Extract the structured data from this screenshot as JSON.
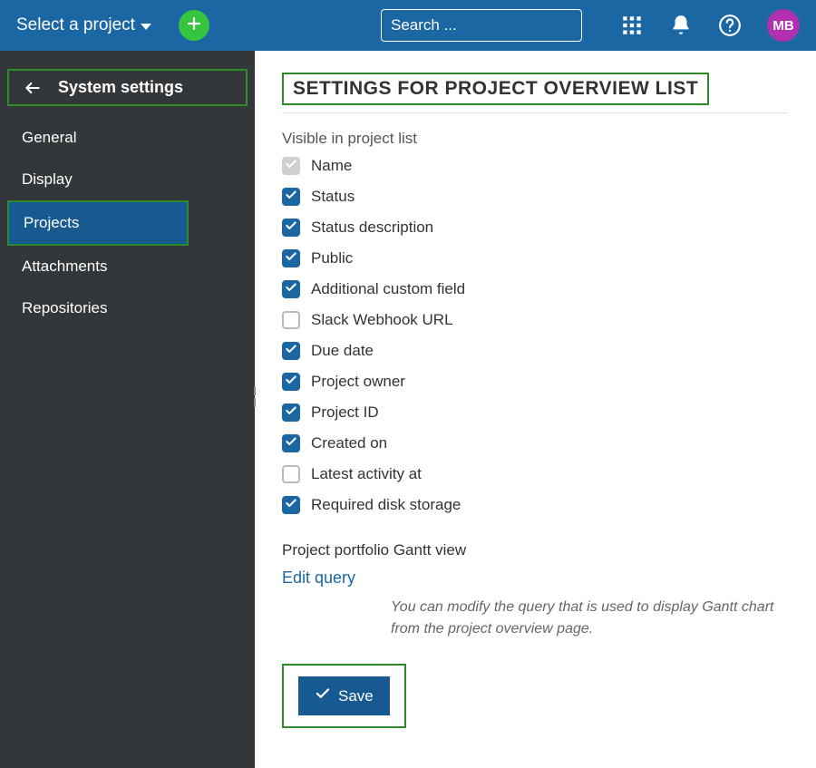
{
  "header": {
    "project_selector_label": "Select a project",
    "search_placeholder": "Search ...",
    "avatar_initials": "MB"
  },
  "sidebar": {
    "title": "System settings",
    "items": [
      {
        "label": "General",
        "active": false
      },
      {
        "label": "Display",
        "active": false
      },
      {
        "label": "Projects",
        "active": true
      },
      {
        "label": "Attachments",
        "active": false
      },
      {
        "label": "Repositories",
        "active": false
      }
    ]
  },
  "main": {
    "title": "SETTINGS FOR PROJECT OVERVIEW LIST",
    "visible_section_label": "Visible in project list",
    "visible_options": [
      {
        "label": "Name",
        "checked": true,
        "disabled": true
      },
      {
        "label": "Status",
        "checked": true,
        "disabled": false
      },
      {
        "label": "Status description",
        "checked": true,
        "disabled": false
      },
      {
        "label": "Public",
        "checked": true,
        "disabled": false
      },
      {
        "label": "Additional custom field",
        "checked": true,
        "disabled": false
      },
      {
        "label": "Slack Webhook URL",
        "checked": false,
        "disabled": false
      },
      {
        "label": "Due date",
        "checked": true,
        "disabled": false
      },
      {
        "label": "Project owner",
        "checked": true,
        "disabled": false
      },
      {
        "label": "Project ID",
        "checked": true,
        "disabled": false
      },
      {
        "label": "Created on",
        "checked": true,
        "disabled": false
      },
      {
        "label": "Latest activity at",
        "checked": false,
        "disabled": false
      },
      {
        "label": "Required disk storage",
        "checked": true,
        "disabled": false
      }
    ],
    "gantt_label": "Project portfolio Gantt view",
    "edit_query_label": "Edit query",
    "help_text": "You can modify the query that is used to display Gantt chart from the project overview page.",
    "save_label": "Save"
  }
}
